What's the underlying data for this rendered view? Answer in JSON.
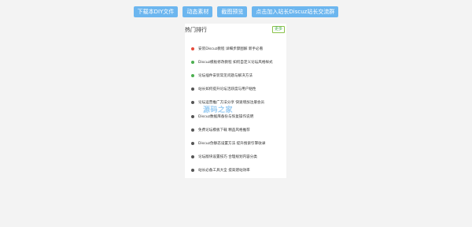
{
  "toolbar": {
    "buttons": [
      {
        "label": "下载本DIY文件"
      },
      {
        "label": "动态素材"
      },
      {
        "label": "截图预览"
      },
      {
        "label": "点击加入站长Discuz站长交流群"
      }
    ]
  },
  "panel": {
    "title": "热门排行",
    "title_sub": "",
    "more": "更多",
    "items": [
      {
        "text": "安装Discuz教程 详细步骤图解 新手必看",
        "dot_color": "#e74c3c"
      },
      {
        "text": "Discuz模板修改教程 如何自定义论坛风格样式",
        "dot_color": "#4caf50"
      },
      {
        "text": "论坛插件安装常见问题与解决方法",
        "dot_color": "#4caf50"
      },
      {
        "text": "站长如何提升论坛活跃度与用户粘性",
        "dot_color": "#555555"
      },
      {
        "text": "论坛运营推广方法分享 快速增加注册会员",
        "dot_color": "#555555"
      },
      {
        "text": "Discuz数据库备份与恢复操作说明",
        "dot_color": "#555555"
      },
      {
        "text": "免费论坛模板下载 精品风格推荐",
        "dot_color": "#555555"
      },
      {
        "text": "Discuz伪静态设置方法 提升搜索引擎收录",
        "dot_color": "#555555"
      },
      {
        "text": "论坛版块设置技巧 合理规划内容分类",
        "dot_color": "#555555"
      },
      {
        "text": "站长必备工具大全 提高建站效率",
        "dot_color": "#555555"
      }
    ]
  },
  "watermark": "源码之家"
}
